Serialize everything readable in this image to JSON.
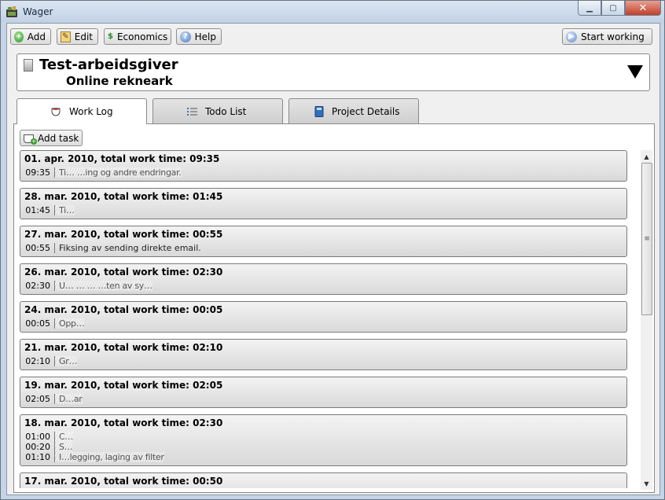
{
  "window": {
    "title": "Wager"
  },
  "toolbar": {
    "add_label": "Add",
    "edit_label": "Edit",
    "economics_label": "Economics",
    "help_label": "Help",
    "start_label": "Start working"
  },
  "employer": {
    "name": "Test-arbeidsgiver",
    "project": "Online rekneark"
  },
  "tabs": {
    "work_log": "Work Log",
    "todo_list": "Todo List",
    "project_details": "Project Details"
  },
  "worklog": {
    "add_task_label": "Add task",
    "entries": [
      {
        "header": "01. apr. 2010, total work time: 09:35",
        "tasks": [
          {
            "time": "09:35",
            "desc": "Ti… …ing og andre endringar."
          }
        ]
      },
      {
        "header": "28. mar. 2010, total work time: 01:45",
        "tasks": [
          {
            "time": "01:45",
            "desc": "Ti…"
          }
        ]
      },
      {
        "header": "27. mar. 2010, total work time: 00:55",
        "tasks": [
          {
            "time": "00:55",
            "desc": "Fiksing av sending direkte email."
          }
        ]
      },
      {
        "header": "26. mar. 2010, total work time: 02:30",
        "tasks": [
          {
            "time": "02:30",
            "desc": "U… … … …ten av sy…"
          }
        ]
      },
      {
        "header": "24. mar. 2010, total work time: 00:05",
        "tasks": [
          {
            "time": "00:05",
            "desc": "Opp…"
          }
        ]
      },
      {
        "header": "21. mar. 2010, total work time: 02:10",
        "tasks": [
          {
            "time": "02:10",
            "desc": "Gr…"
          }
        ]
      },
      {
        "header": "19. mar. 2010, total work time: 02:05",
        "tasks": [
          {
            "time": "02:05",
            "desc": "D…ar"
          }
        ]
      },
      {
        "header": "18. mar. 2010, total work time: 02:30",
        "tasks": [
          {
            "time": "01:00",
            "desc": "C…"
          },
          {
            "time": "00:20",
            "desc": "S…"
          },
          {
            "time": "01:10",
            "desc": "I…legging, laging av filter"
          }
        ]
      },
      {
        "header": "17. mar. 2010, total work time: 00:50",
        "tasks": []
      }
    ]
  },
  "colors": {
    "titlebar": "#c5d4e6",
    "client": "#f0f0f0",
    "entry": "#e6e6e6",
    "close": "#c0402c"
  }
}
